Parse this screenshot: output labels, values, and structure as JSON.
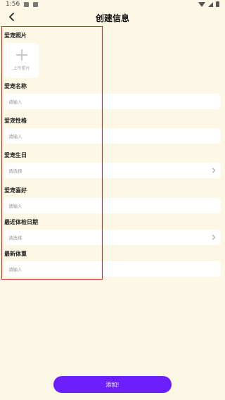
{
  "status_bar": {
    "time": "1:56"
  },
  "header": {
    "title": "创建信息"
  },
  "sections": {
    "photo": {
      "label": "爱宠照片",
      "upload_text": "上传照片"
    },
    "name": {
      "label": "爱宠名称",
      "placeholder": "请输入"
    },
    "personality": {
      "label": "爱宠性格",
      "placeholder": "请输入"
    },
    "birthday": {
      "label": "爱宠生日",
      "placeholder": "请选择"
    },
    "hobby": {
      "label": "爱宠喜好",
      "placeholder": "请输入"
    },
    "checkup_date": {
      "label": "最近体检日期",
      "placeholder": "请选择"
    },
    "weight": {
      "label": "最新体重",
      "placeholder": "请输入"
    }
  },
  "footer": {
    "add_button_label": "添加!"
  },
  "colors": {
    "background": "#fdf8e6",
    "accent": "#6c1ffa",
    "highlight_box": "#d22222"
  }
}
